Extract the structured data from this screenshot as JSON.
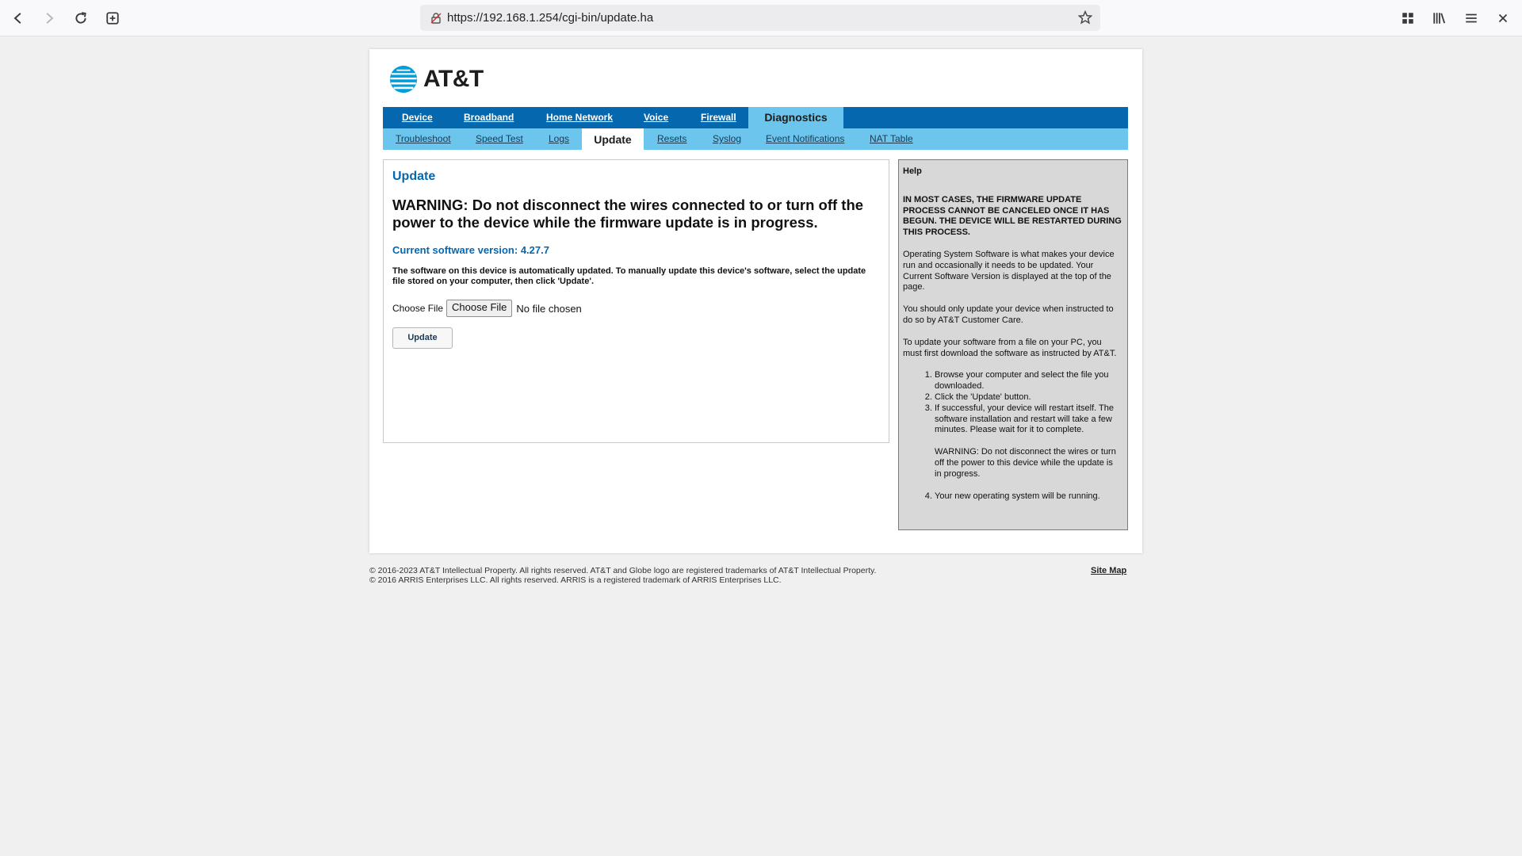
{
  "browser": {
    "url": "https://192.168.1.254/cgi-bin/update.ha"
  },
  "brand": {
    "name": "AT&T",
    "colors": {
      "nav_dark": "#0568ae",
      "nav_light": "#6bc5ec"
    }
  },
  "nav": {
    "primary": [
      "Device",
      "Broadband",
      "Home Network",
      "Voice",
      "Firewall"
    ],
    "primary_active": "Diagnostics",
    "secondary_left": [
      "Troubleshoot",
      "Speed Test",
      "Logs"
    ],
    "secondary_active": "Update",
    "secondary_right": [
      "Resets",
      "Syslog",
      "Event Notifications",
      "NAT Table"
    ]
  },
  "main": {
    "title": "Update",
    "warning": "WARNING: Do not disconnect the wires connected to or turn off the power to the device while the firmware update is in progress.",
    "version": "Current software version: 4.27.7",
    "description": "The software on this device is automatically updated. To manually update this device's software, select the update file stored on your computer, then click 'Update'.",
    "choose_label": "Choose File",
    "file_button": "Choose File",
    "file_status": "No file chosen",
    "update_button": "Update"
  },
  "help": {
    "title": "Help",
    "caps": "IN MOST CASES, THE FIRMWARE UPDATE PROCESS CANNOT BE CANCELED ONCE IT HAS BEGUN. THE DEVICE WILL BE RESTARTED DURING THIS PROCESS.",
    "p1": "Operating System Software is what makes your device run and occasionally it needs to be updated. Your Current Software Version is displayed at the top of the page.",
    "p2": "You should only update your device when instructed to do so by AT&T Customer Care.",
    "p3": "To update your software from a file on your PC, you must first download the software as instructed by AT&T.",
    "steps": [
      "Browse your computer and select the file you downloaded.",
      "Click the 'Update' button.",
      "If successful, your device will restart itself. The software installation and restart will take a few minutes. Please wait for it to complete.",
      "Your new operating system will be running."
    ],
    "step_warning": "WARNING: Do not disconnect the wires or turn off the power to this device while the update is in progress."
  },
  "footer": {
    "line1": "© 2016-2023 AT&T Intellectual Property. All rights reserved. AT&T and Globe logo are registered trademarks of AT&T Intellectual Property.",
    "line2": "© 2016 ARRIS Enterprises LLC. All rights reserved. ARRIS is a registered trademark of ARRIS Enterprises LLC.",
    "sitemap": "Site Map"
  }
}
